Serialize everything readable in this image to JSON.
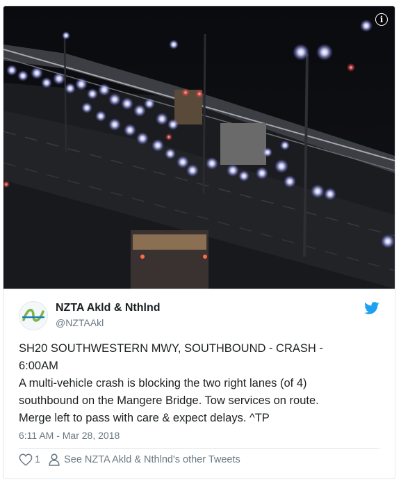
{
  "tweet": {
    "display_name": "NZTA Akld & Nthlnd",
    "handle": "@NZTAAkl",
    "text": "SH20 SOUTHWESTERN MWY, SOUTHBOUND - CRASH -\n6:00AM\nA multi-vehicle crash is blocking the two right lanes (of 4)\nsouthbound on the Mangere Bridge. Tow services on route.\nMerge left to pass with care & expect delays. ^TP",
    "timestamp": "6:11 AM - Mar 28, 2018",
    "like_count": "1",
    "see_more_label": "See NZTA Akld & Nthlnd's other Tweets",
    "info_glyph": "i"
  },
  "colors": {
    "twitter_blue": "#1da1f2",
    "text_primary": "#1c2022",
    "text_secondary": "#697882",
    "border": "#e1e8ed",
    "nzta_green": "#7ab648",
    "nzta_blue": "#1f7fb8"
  },
  "icons": {
    "info": "info-icon",
    "bird": "twitter-bird-icon",
    "like": "heart-icon",
    "profile": "person-icon"
  }
}
